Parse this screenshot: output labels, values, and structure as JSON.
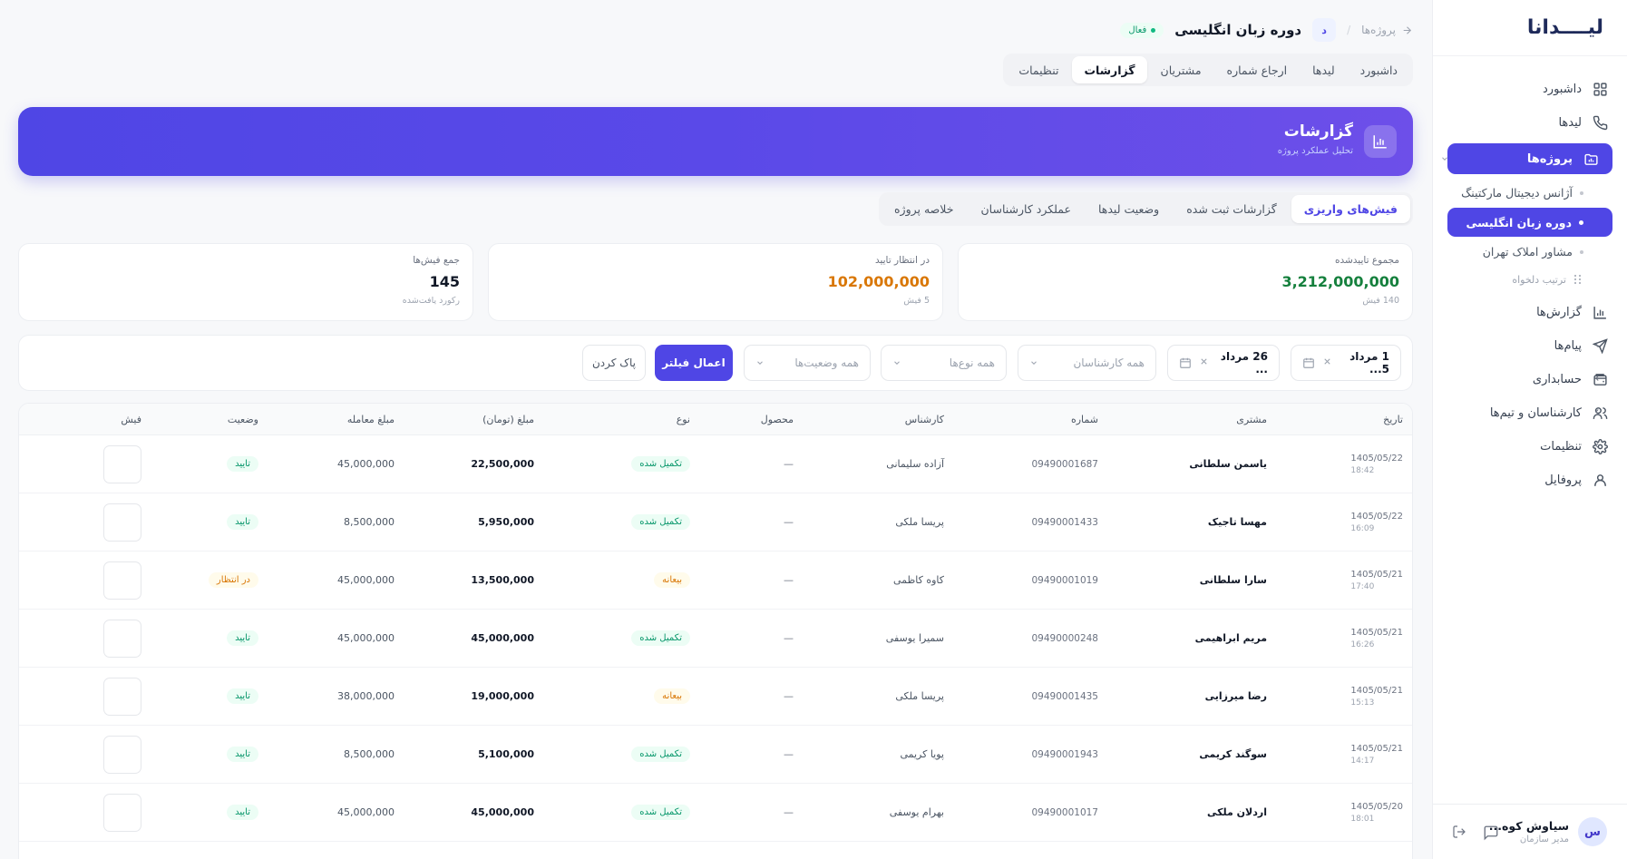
{
  "sidebar": {
    "logo": "لیــــدانا",
    "items": [
      {
        "label": "داشبورد"
      },
      {
        "label": "لیدها"
      },
      {
        "label": "پروژه‌ها"
      },
      {
        "label": "گزارش‌ها"
      },
      {
        "label": "پیام‌ها"
      },
      {
        "label": "حسابداری"
      },
      {
        "label": "کارشناسان و تیم‌ها"
      },
      {
        "label": "تنظیمات"
      },
      {
        "label": "پروفایل"
      }
    ],
    "projects": [
      {
        "label": "آژانس دیجیتال مارکتینگ"
      },
      {
        "label": "دوره زبان انگلیسی"
      },
      {
        "label": "مشاور املاک تهران"
      }
    ],
    "sort_label": "ترتیب دلخواه",
    "user": {
      "initial": "س",
      "name": "سیاوش کوه...",
      "role": "مدیر سازمان"
    }
  },
  "header": {
    "back_label": "پروژه‌ها",
    "separator": "/",
    "project_initial": "د",
    "project_title": "دوره زبان انگلیسی",
    "status": "فعال",
    "tabs": [
      "داشبورد",
      "لیدها",
      "ارجاع شماره",
      "مشتریان",
      "گزارشات",
      "تنظیمات"
    ]
  },
  "hero": {
    "title": "گزارشات",
    "subtitle": "تحلیل عملکرد پروژه"
  },
  "report_tabs": [
    "فیش‌های واریزی",
    "گزارشات ثبت شده",
    "وضعیت لیدها",
    "عملکرد کارشناسان",
    "خلاصه پروژه"
  ],
  "stats": [
    {
      "label": "مجموع تاییدشده",
      "value": "3,212,000,000",
      "sub": "140 فیش",
      "color": "#15803d"
    },
    {
      "label": "در انتظار تایید",
      "value": "102,000,000",
      "sub": "5 فیش",
      "color": "#d97706"
    },
    {
      "label": "جمع فیش‌ها",
      "value": "145",
      "sub": "رکورد یافت‌شده",
      "color": "#111827"
    }
  ],
  "filters": {
    "from_date": "1 مرداد 5...",
    "to_date": "26 مرداد ...",
    "expert": "همه کارشناسان",
    "type": "همه نوع‌ها",
    "status": "همه وضعیت‌ها",
    "apply": "اعمال فیلتر",
    "clear": "پاک کردن"
  },
  "table": {
    "headers": [
      "تاریخ",
      "مشتری",
      "شماره",
      "کارشناس",
      "محصول",
      "نوع",
      "مبلغ (تومان)",
      "مبلغ معامله",
      "وضعیت",
      "فیش"
    ],
    "rows": [
      {
        "date": "1405/05/22",
        "time": "18:42",
        "customer": "یاسمن سلطانی",
        "phone": "09490001687",
        "expert": "آزاده سلیمانی",
        "product": "—",
        "type": "تکمیل شده",
        "amount": "22,500,000",
        "deal": "45,000,000",
        "status": "تایید"
      },
      {
        "date": "1405/05/22",
        "time": "16:09",
        "customer": "مهسا تاجیک",
        "phone": "09490001433",
        "expert": "پریسا ملکی",
        "product": "—",
        "type": "تکمیل شده",
        "amount": "5,950,000",
        "deal": "8,500,000",
        "status": "تایید"
      },
      {
        "date": "1405/05/21",
        "time": "17:40",
        "customer": "سارا سلطانی",
        "phone": "09490001019",
        "expert": "کاوه کاظمی",
        "product": "—",
        "type": "بیعانه",
        "amount": "13,500,000",
        "deal": "45,000,000",
        "status": "در انتظار"
      },
      {
        "date": "1405/05/21",
        "time": "16:26",
        "customer": "مریم ابراهیمی",
        "phone": "09490000248",
        "expert": "سمیرا یوسفی",
        "product": "—",
        "type": "تکمیل شده",
        "amount": "45,000,000",
        "deal": "45,000,000",
        "status": "تایید"
      },
      {
        "date": "1405/05/21",
        "time": "15:13",
        "customer": "رضا میرزایی",
        "phone": "09490001435",
        "expert": "پریسا ملکی",
        "product": "—",
        "type": "بیعانه",
        "amount": "19,000,000",
        "deal": "38,000,000",
        "status": "تایید"
      },
      {
        "date": "1405/05/21",
        "time": "14:17",
        "customer": "سوگند کریمی",
        "phone": "09490001943",
        "expert": "پویا کریمی",
        "product": "—",
        "type": "تکمیل شده",
        "amount": "5,100,000",
        "deal": "8,500,000",
        "status": "تایید"
      },
      {
        "date": "1405/05/20",
        "time": "18:01",
        "customer": "اردلان ملکی",
        "phone": "09490001017",
        "expert": "بهرام یوسفی",
        "product": "—",
        "type": "تکمیل شده",
        "amount": "45,000,000",
        "deal": "45,000,000",
        "status": "تایید"
      }
    ]
  },
  "colors": {
    "accent": "#4f46e5",
    "green": "#059669",
    "amber": "#d97706"
  }
}
